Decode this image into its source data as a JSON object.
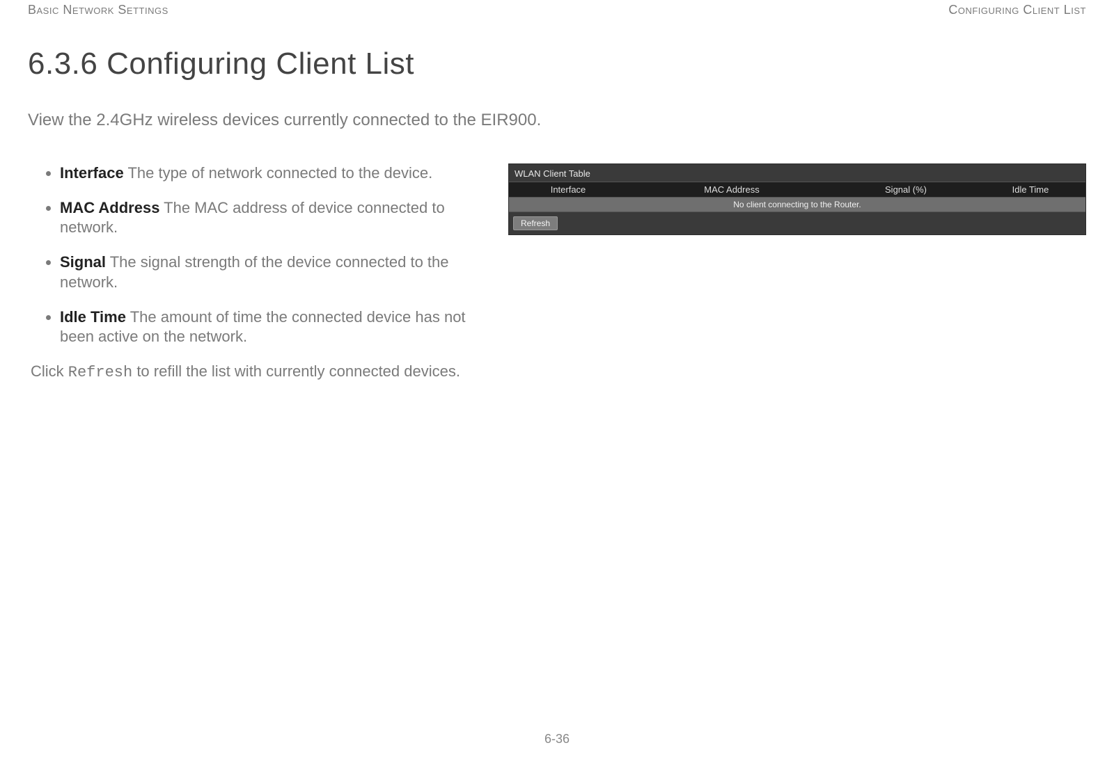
{
  "header": {
    "left": "Basic Network Settings",
    "right": "Configuring Client List"
  },
  "section": {
    "title": "6.3.6 Configuring Client List",
    "lead": "View the 2.4GHz wireless devices currently connected to the EIR900."
  },
  "bullets": [
    {
      "term": "Interface",
      "desc": "The type of network connected to the device."
    },
    {
      "term": "MAC Address",
      "desc": "The MAC address of device connected to network."
    },
    {
      "term": "Signal",
      "desc": "The signal strength of the device connected to the network."
    },
    {
      "term": "Idle Time",
      "desc": "The amount of time the connected device has not been active on the network."
    }
  ],
  "after_list": {
    "prefix": "Click ",
    "code": "Refresh",
    "suffix": " to refill the list with currently connected devices."
  },
  "wlan_panel": {
    "title": "WLAN Client Table",
    "columns": {
      "interface": "Interface",
      "mac": "MAC Address",
      "signal": "Signal (%)",
      "idle": "Idle Time"
    },
    "empty_message": "No client connecting to the Router.",
    "refresh_label": "Refresh"
  },
  "page_number": "6-36"
}
